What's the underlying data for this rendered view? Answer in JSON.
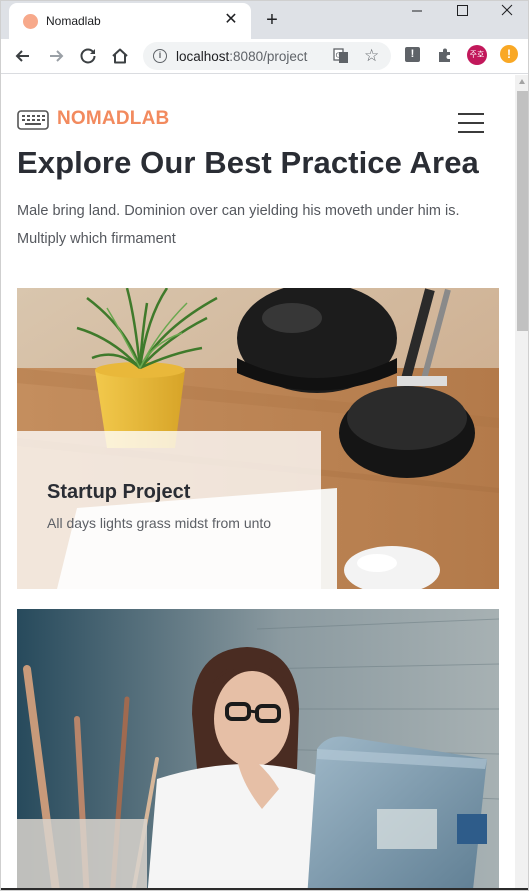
{
  "browser": {
    "tab_title": "Nomadlab",
    "tab_close": "✕",
    "new_tab": "+",
    "url_host": "localhost",
    "url_path": ":8080/project",
    "profile_initials": "주호"
  },
  "nav": {
    "brand": "NOMADLAB"
  },
  "hero": {
    "title": "Explore Our Best Practice Area",
    "description": "Male bring land. Dominion over can yielding his moveth under him is. Multiply which firmament"
  },
  "projects": [
    {
      "title": "Startup Project",
      "description": "All days lights grass midst from unto"
    }
  ],
  "colors": {
    "brand": "#f28a5e",
    "heading": "#2a2d34",
    "body_text": "#55585e"
  }
}
